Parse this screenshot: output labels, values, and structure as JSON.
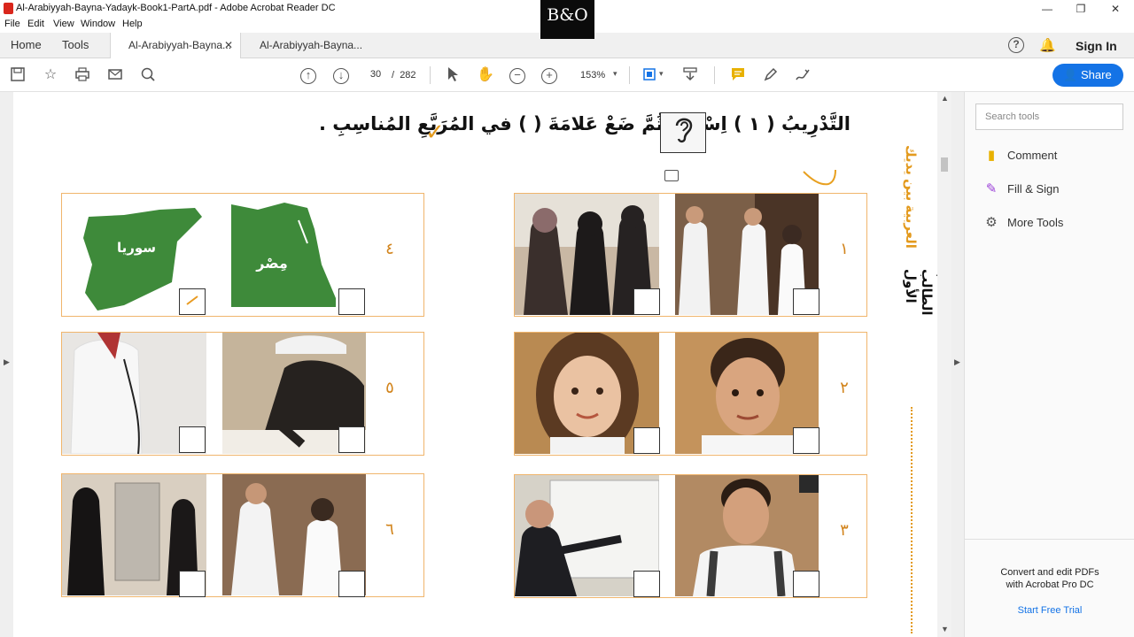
{
  "window": {
    "title": "Al-Arabiyyah-Bayna-Yadayk-Book1-PartA.pdf - Adobe Acrobat Reader DC",
    "minimize": "—",
    "maximize": "❐",
    "close": "✕",
    "overlay_logo": "B&O"
  },
  "menu": [
    "File",
    "Edit",
    "View",
    "Window",
    "Help"
  ],
  "tabs": {
    "home": "Home",
    "tools": "Tools",
    "doc_tabs": [
      {
        "label": "Al-Arabiyyah-Bayna...",
        "active": true,
        "close": "✕"
      },
      {
        "label": "Al-Arabiyyah-Bayna...",
        "active": false
      }
    ],
    "help": "?",
    "sign_in": "Sign In"
  },
  "toolbar": {
    "page_current": "30",
    "page_sep": "/",
    "page_total": "282",
    "zoom": "153%",
    "share": "Share"
  },
  "document": {
    "heading": "التَّدْرِيبُ ( ١ ) اِسْتَمِعْ ثُمَّ ضَعْ عَلامَةَ (   ) في المُرَبَّعِ المُناسِبِ .",
    "side_title_orange": "العربية بين يديك",
    "side_title_black": "كتاب الطالب الأول",
    "cards": [
      {
        "num": "١",
        "labels": []
      },
      {
        "num": "٢",
        "labels": []
      },
      {
        "num": "٣",
        "labels": []
      },
      {
        "num": "٤",
        "labels": [
          "سوريا",
          "مِصْر"
        ]
      },
      {
        "num": "٥",
        "labels": []
      },
      {
        "num": "٦",
        "labels": []
      }
    ]
  },
  "right_panel": {
    "search_placeholder": "Search tools",
    "items": [
      {
        "label": "Comment",
        "icon": "comment-icon",
        "color": "#e8b100"
      },
      {
        "label": "Fill & Sign",
        "icon": "fill-sign-icon",
        "color": "#9b3fd8"
      },
      {
        "label": "More Tools",
        "icon": "more-tools-icon",
        "color": "#555555"
      }
    ],
    "promo": "Convert and edit PDFs with Acrobat Pro DC",
    "trial": "Start Free Trial"
  },
  "colors": {
    "accent": "#1473e6",
    "card_border": "#f0b56c",
    "orange_text": "#d2841c",
    "map_green": "#3e8a3a"
  }
}
